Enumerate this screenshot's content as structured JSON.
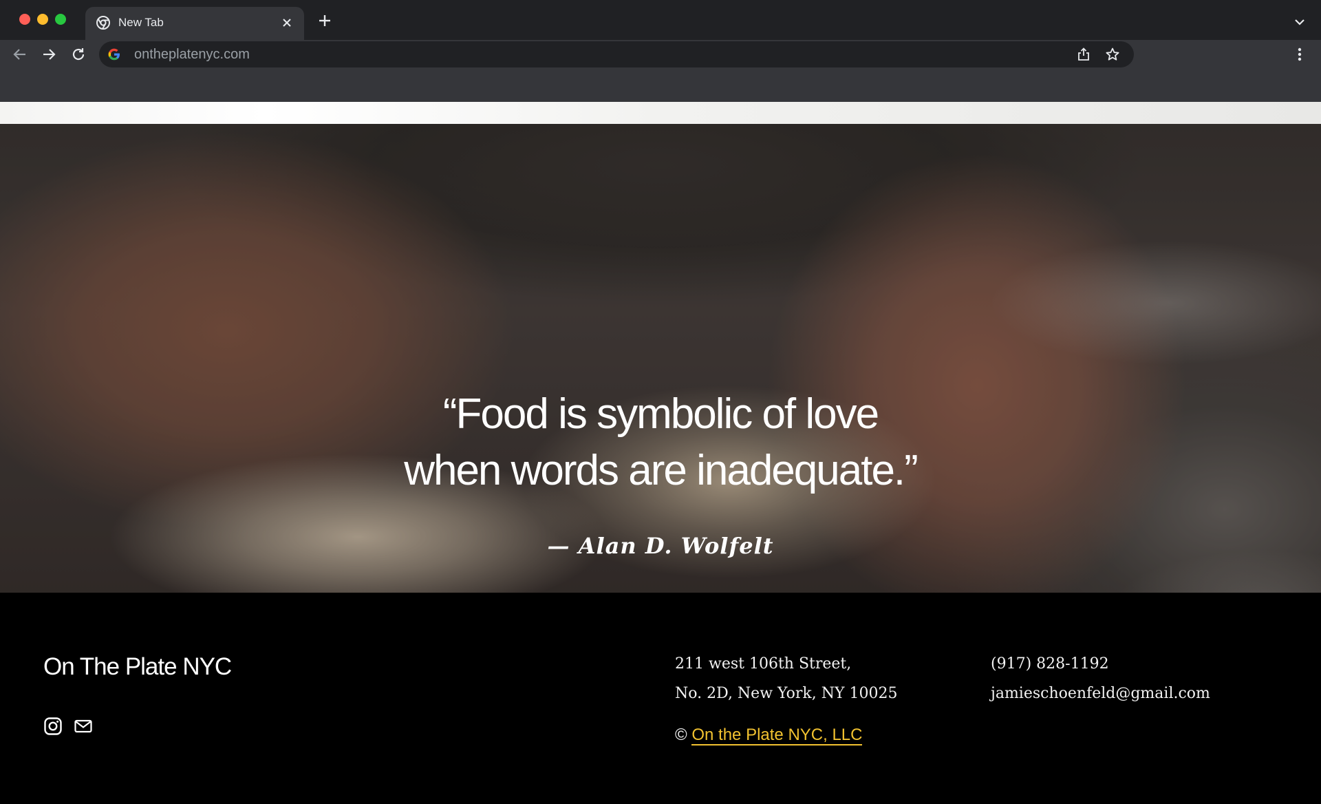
{
  "browser": {
    "tab_title": "New Tab",
    "url": "ontheplatenyc.com",
    "colors": {
      "frame": "#202124",
      "toolbar": "#35363a",
      "text": "#e8eaed"
    },
    "icons": [
      "chrome-favicon-icon",
      "close-icon",
      "plus-icon",
      "chevron-down-icon",
      "back-arrow-icon",
      "forward-arrow-icon",
      "reload-icon",
      "google-g-icon",
      "share-icon",
      "star-icon",
      "kebab-menu-icon"
    ]
  },
  "hero": {
    "quote_lines": [
      "“Food is symbolic of love",
      "when words are inadequate.”"
    ],
    "attribution": "— Alan D. Wolfelt"
  },
  "footer": {
    "brand": "On The Plate NYC",
    "address_lines": [
      "211 west 106th Street,",
      "No. 2D, New York, NY 10025"
    ],
    "phone": "(917) 828-1192",
    "email": "jamieschoenfeld@gmail.com",
    "copyright_symbol": "©",
    "copyright_link": "On the Plate NYC, LLC",
    "accent_color": "#f2c230",
    "social_icons": [
      "instagram-icon",
      "mail-icon"
    ]
  }
}
